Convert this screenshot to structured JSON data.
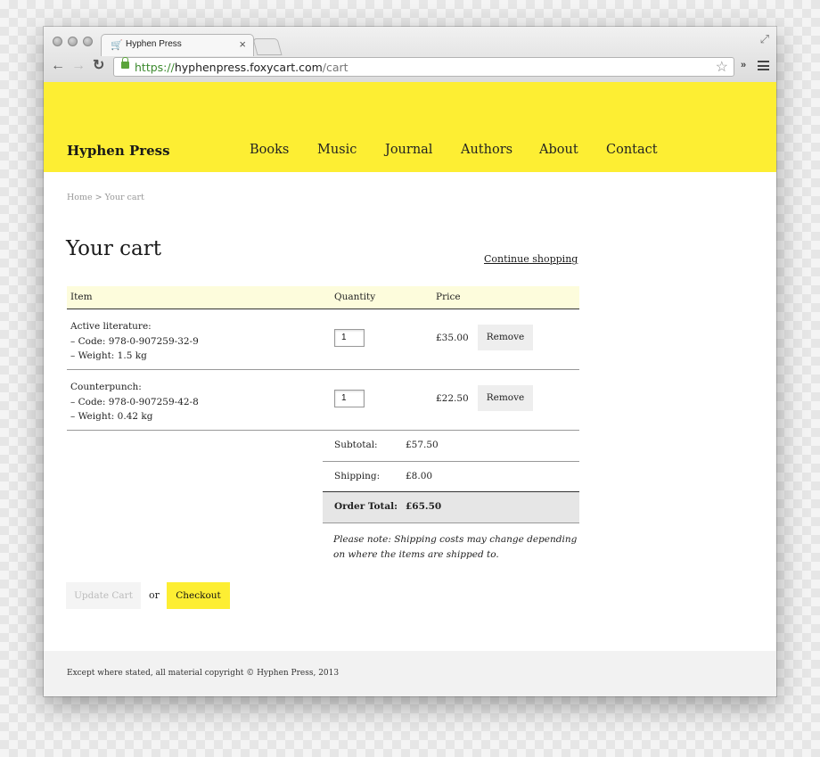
{
  "browser": {
    "tab_title": "Hyphen Press",
    "tab_close": "×",
    "url_scheme": "https://",
    "url_host": "hyphenpress.foxycart.com",
    "url_path": "/cart",
    "back": "←",
    "forward": "→",
    "reload": "↻",
    "star": "☆",
    "extensions": "»"
  },
  "header": {
    "logo": "Hyphen Press",
    "nav": [
      "Books",
      "Music",
      "Journal",
      "Authors",
      "About",
      "Contact"
    ],
    "accent_color": "#fdee33"
  },
  "breadcrumb": {
    "home": "Home",
    "separator": ">",
    "current": "Your cart"
  },
  "cart": {
    "title": "Your cart",
    "continue_shopping": "Continue shopping",
    "columns": {
      "item": "Item",
      "quantity": "Quantity",
      "price": "Price"
    },
    "items": [
      {
        "name": "Active literature:",
        "code": "– Code: 978-0-907259-32-9",
        "weight": "– Weight: 1.5 kg",
        "quantity": "1",
        "price": "£35.00",
        "remove": "Remove"
      },
      {
        "name": "Counterpunch:",
        "code": "– Code: 978-0-907259-42-8",
        "weight": "– Weight: 0.42 kg",
        "quantity": "1",
        "price": "£22.50",
        "remove": "Remove"
      }
    ],
    "subtotal_label": "Subtotal:",
    "subtotal_value": "£57.50",
    "shipping_label": "Shipping:",
    "shipping_value": "£8.00",
    "total_label": "Order Total:",
    "total_value": "£65.50",
    "note": "Please note: Shipping costs may change depending on where the items are shipped to.",
    "update_button": "Update Cart",
    "or": "or",
    "checkout_button": "Checkout"
  },
  "footer": {
    "text": "Except where stated, all material copyright © Hyphen Press, 2013"
  }
}
